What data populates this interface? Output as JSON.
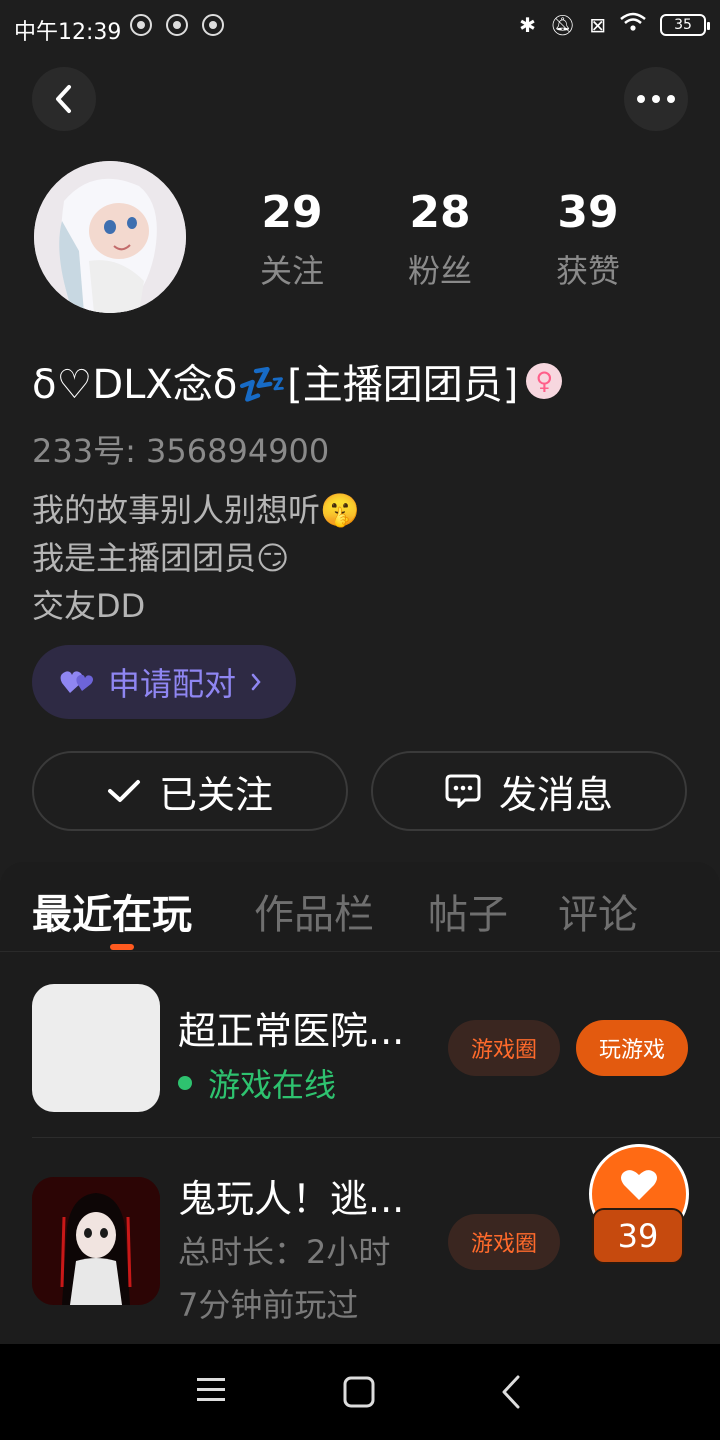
{
  "status_bar": {
    "time": "中午12:39",
    "battery": "35"
  },
  "profile": {
    "stats": [
      {
        "value": "29",
        "label": "关注"
      },
      {
        "value": "28",
        "label": "粉丝"
      },
      {
        "value": "39",
        "label": "获赞"
      }
    ],
    "nickname": "δ♡DLX念δ💤[主播团团员]",
    "gender_symbol": "♀",
    "uid": "233号: 356894900",
    "bio_lines": [
      "我的故事别人别想听🤫",
      "我是主播团团员😏",
      "交友DD"
    ],
    "pair_label": "申请配对",
    "follow_label": "已关注",
    "message_label": "发消息"
  },
  "tabs": [
    {
      "label": "最近在玩",
      "active": true
    },
    {
      "label": "作品栏",
      "active": false
    },
    {
      "label": "帖子",
      "active": false
    },
    {
      "label": "评论",
      "active": false
    }
  ],
  "games": [
    {
      "title": "超正常医院...",
      "status": "游戏在线",
      "circle_label": "游戏圈",
      "play_label": "玩游戏"
    },
    {
      "title": "鬼玩人！逃...",
      "duration": "总时长：2小时",
      "last_played": "7分钟前玩过",
      "circle_label": "游戏圈"
    }
  ],
  "like_badge": {
    "count": "39"
  },
  "colors": {
    "accent": "#ff6a14",
    "online": "#2ec26f",
    "pair_text": "#8f86f2"
  }
}
